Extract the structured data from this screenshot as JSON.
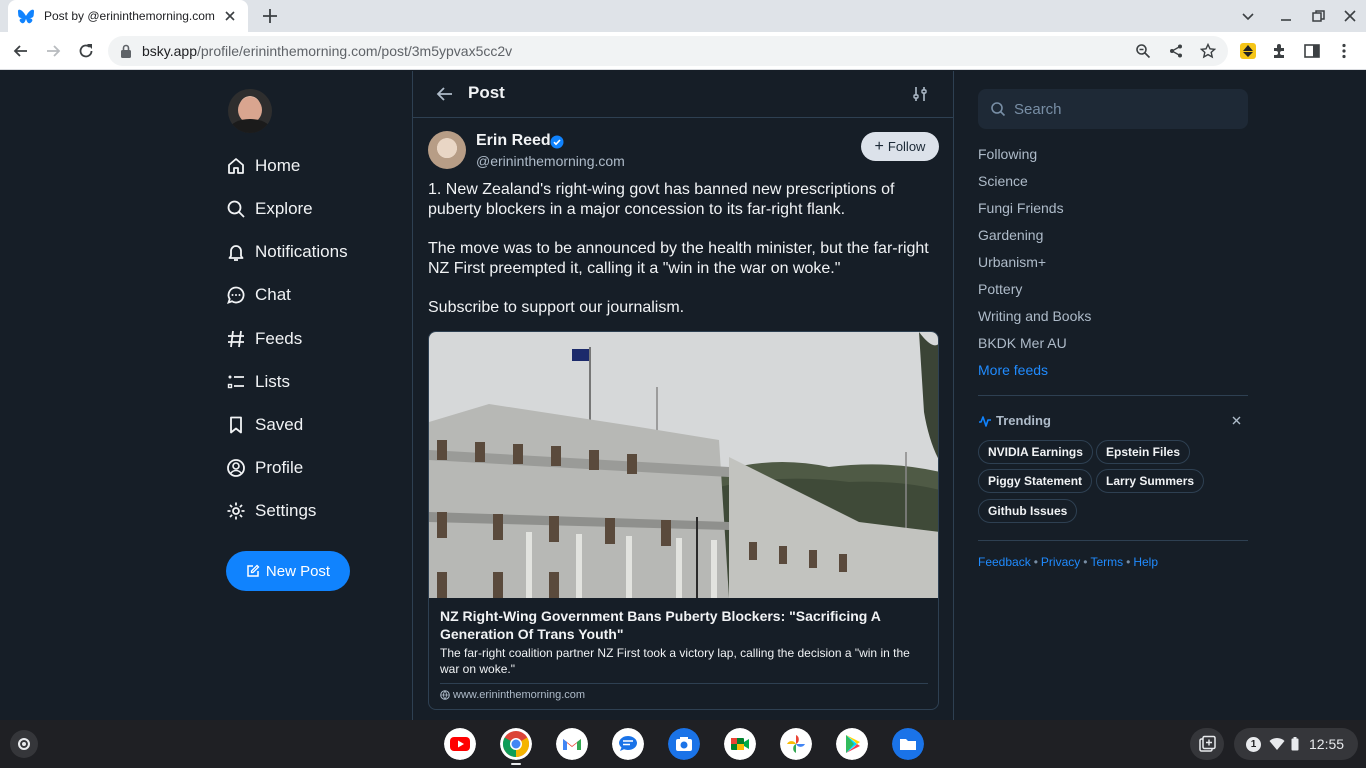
{
  "browser": {
    "tab_title": "Post by @erininthemorning.com",
    "url_host": "bsky.app",
    "url_path": "/profile/erininthemorning.com/post/3m5ypvax5cc2v"
  },
  "nav": {
    "items": [
      {
        "label": "Home",
        "icon": "home-icon"
      },
      {
        "label": "Explore",
        "icon": "search-icon"
      },
      {
        "label": "Notifications",
        "icon": "bell-icon"
      },
      {
        "label": "Chat",
        "icon": "chat-icon"
      },
      {
        "label": "Feeds",
        "icon": "hash-icon"
      },
      {
        "label": "Lists",
        "icon": "list-icon"
      },
      {
        "label": "Saved",
        "icon": "bookmark-icon"
      },
      {
        "label": "Profile",
        "icon": "profile-icon"
      },
      {
        "label": "Settings",
        "icon": "gear-icon"
      }
    ],
    "new_post_label": "New Post"
  },
  "post": {
    "header_title": "Post",
    "author_name": "Erin Reed",
    "author_handle": "@erininthemorning.com",
    "follow_label": "Follow",
    "paragraphs": [
      "1. New Zealand's right-wing govt has banned new prescriptions of puberty blockers in a major concession to its far-right flank.",
      "The move was to be announced by the health minister, but the far-right NZ First preempted it, calling it a \"win in the war on woke.\"",
      "Subscribe to support our journalism."
    ],
    "card": {
      "title": "NZ Right-Wing Government Bans Puberty Blockers: \"Sacrificing A Generation Of Trans Youth\"",
      "description": "The far-right coalition partner NZ First took a victory lap, calling the decision a \"win in the war on woke.\"",
      "domain": "www.erininthemorning.com"
    }
  },
  "sidebar": {
    "search_placeholder": "Search",
    "feeds": [
      "Following",
      "Science",
      "Fungi Friends",
      "Gardening",
      "Urbanism+",
      "Pottery",
      "Writing and Books",
      "BKDK Mer AU"
    ],
    "more_feeds": "More feeds",
    "trending_title": "Trending",
    "trending": [
      "NVIDIA Earnings",
      "Epstein Files",
      "Piggy Statement",
      "Larry Summers",
      "Github Issues"
    ],
    "footer": [
      "Feedback",
      "Privacy",
      "Terms",
      "Help"
    ]
  },
  "shelf": {
    "apps": [
      "youtube-icon",
      "chrome-icon",
      "gmail-icon",
      "messages-icon",
      "camera-icon",
      "meet-icon",
      "photos-icon",
      "play-store-icon",
      "files-icon"
    ],
    "notification_count": "1",
    "time": "12:55"
  },
  "colors": {
    "accent": "#1083fe",
    "background": "#161e27",
    "border": "#2e4052"
  }
}
